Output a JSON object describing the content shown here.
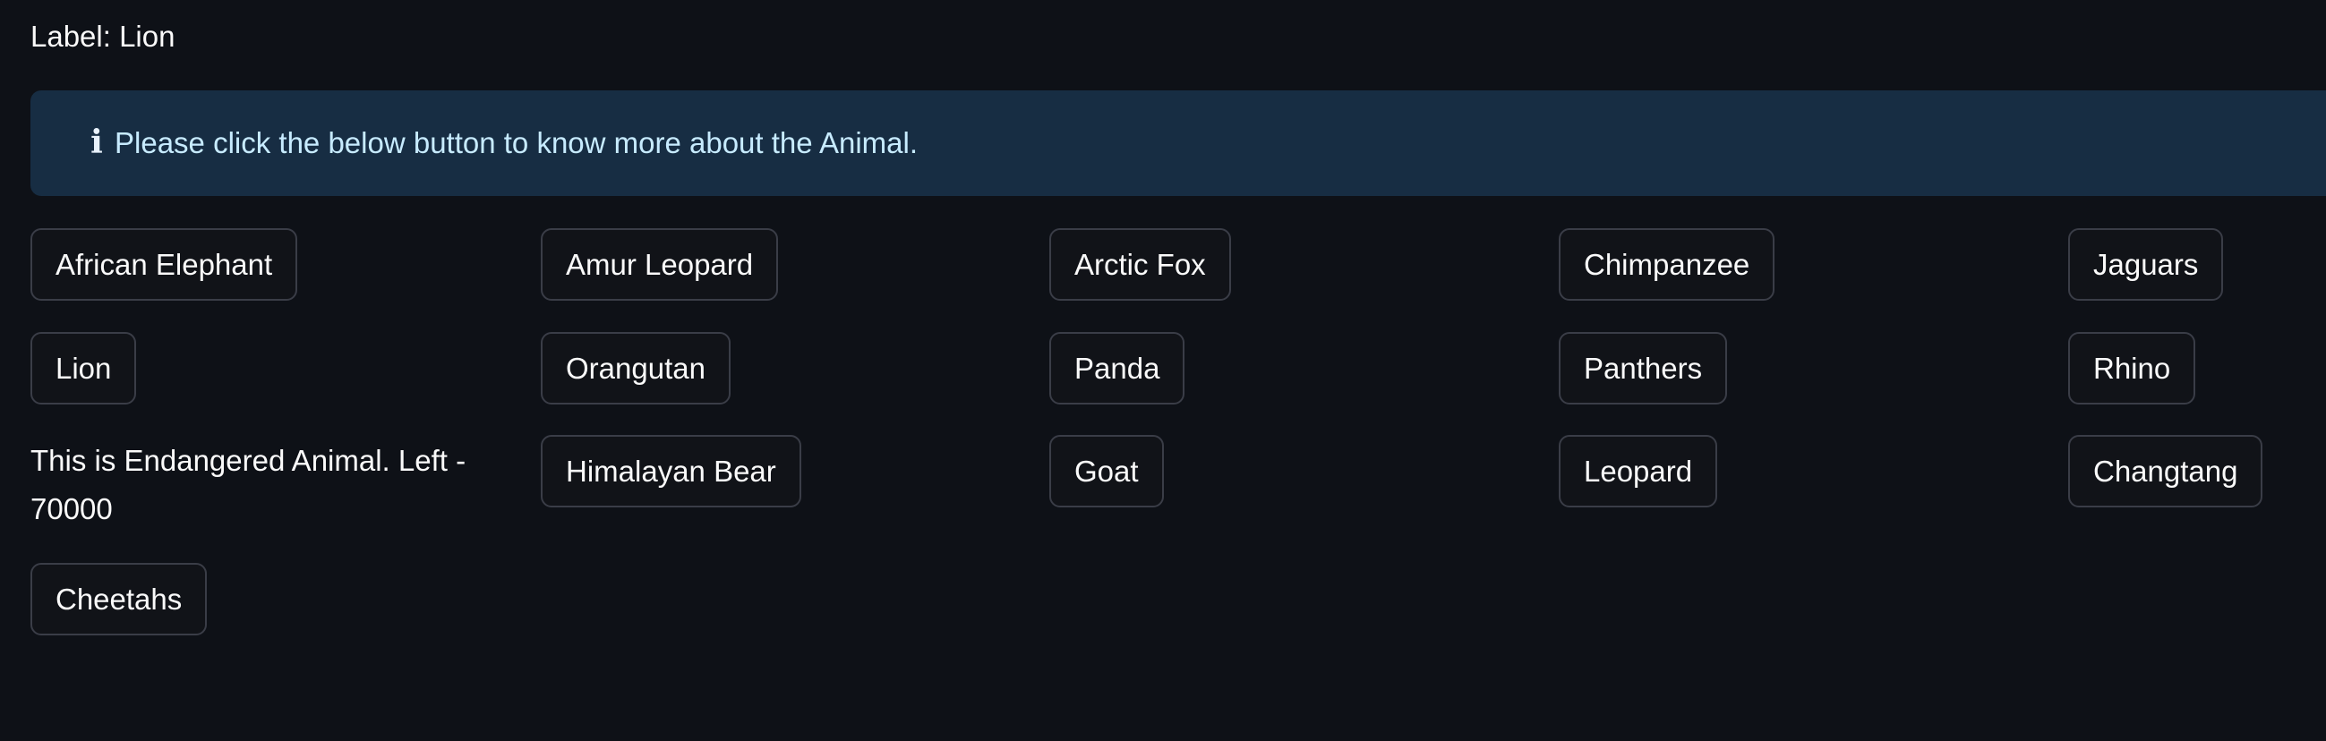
{
  "label_line": "Label: Lion",
  "info": {
    "icon": "info-icon",
    "text": "Please click the below button to know more about the Animal."
  },
  "animals": {
    "african_elephant": "African Elephant",
    "amur_leopard": "Amur Leopard",
    "arctic_fox": "Arctic Fox",
    "chimpanzee": "Chimpanzee",
    "jaguars": "Jaguars",
    "lion": "Lion",
    "orangutan": "Orangutan",
    "panda": "Panda",
    "panthers": "Panthers",
    "rhino": "Rhino",
    "himalayan_bear": "Himalayan Bear",
    "goat": "Goat",
    "leopard": "Leopard",
    "changtang": "Changtang",
    "cheetahs": "Cheetahs"
  },
  "status_text": "This is Endangered Animal. Left - 70000"
}
